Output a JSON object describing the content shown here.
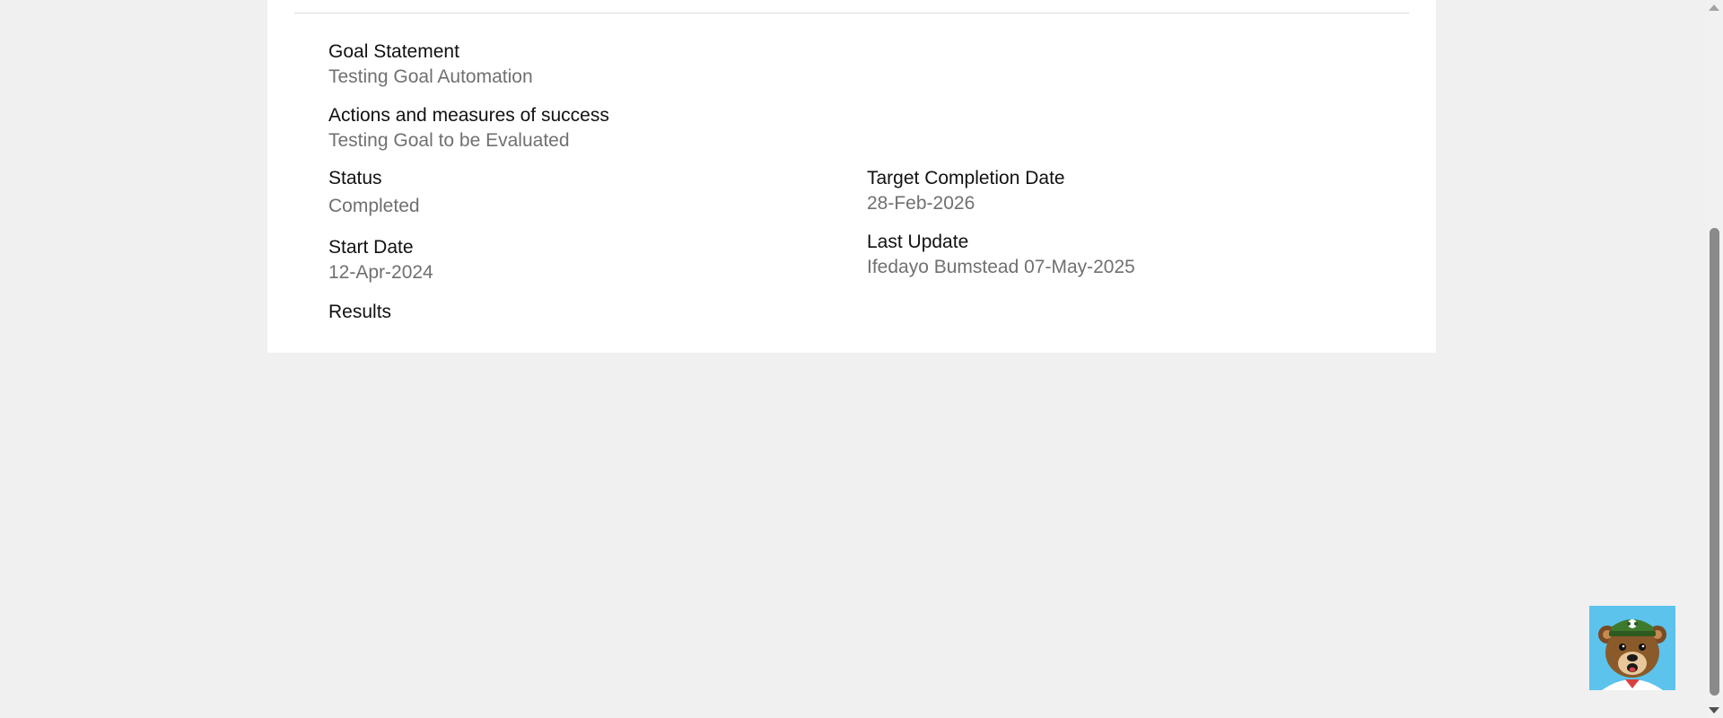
{
  "goal": {
    "goal_statement": {
      "label": "Goal Statement",
      "value": "Testing Goal Automation"
    },
    "actions": {
      "label": "Actions and measures of success",
      "value": "Testing Goal to be Evaluated"
    },
    "status": {
      "label": "Status",
      "value": "Completed"
    },
    "target_date": {
      "label": "Target Completion Date",
      "value": "28-Feb-2026"
    },
    "start_date": {
      "label": "Start Date",
      "value": "12-Apr-2024"
    },
    "last_update": {
      "label": "Last Update",
      "value": "Ifedayo Bumstead 07-May-2025"
    },
    "results": {
      "label": "Results"
    }
  },
  "widget": {
    "icon": "bear-mascot-icon",
    "background": "#5bc3ec"
  },
  "colors": {
    "label": "#111111",
    "value": "#707070",
    "page_bg": "#f0f0f0",
    "card_bg": "#ffffff"
  }
}
